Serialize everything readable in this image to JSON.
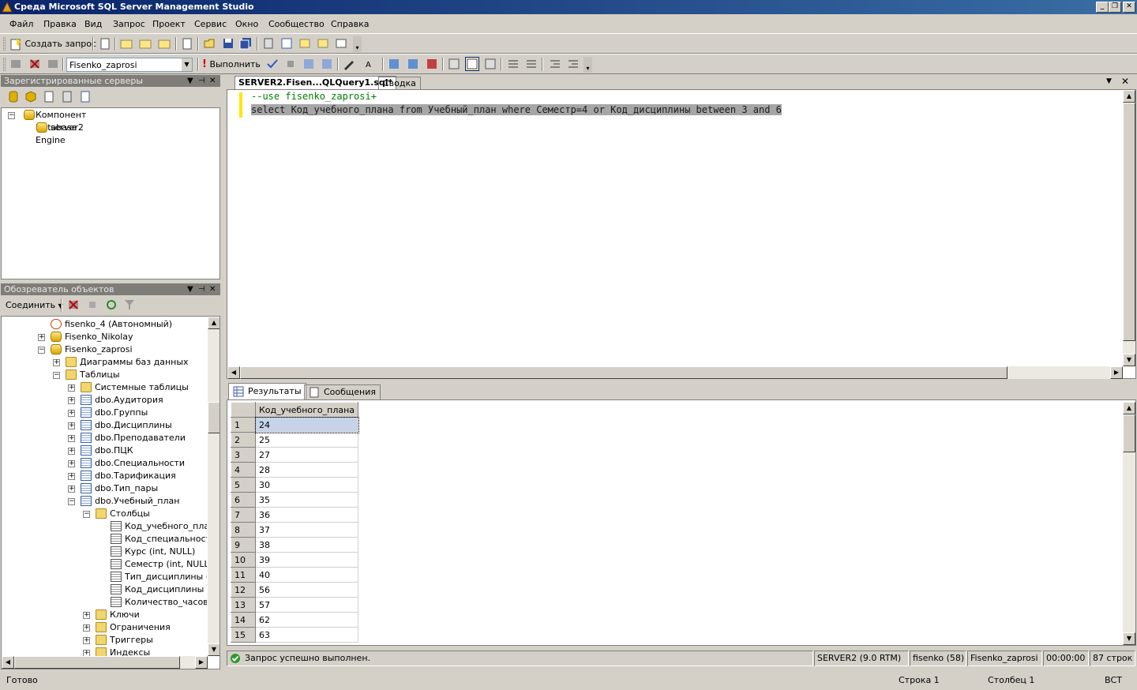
{
  "window": {
    "title": "Среда Microsoft SQL Server Management Studio"
  },
  "menu": [
    "Файл",
    "Правка",
    "Вид",
    "Запрос",
    "Проект",
    "Сервис",
    "Окно",
    "Сообщество",
    "Справка"
  ],
  "toolbar1": {
    "new_query": "Создать запрос"
  },
  "toolbar2": {
    "database": "Fisenko_zaprosi",
    "execute": "Выполнить"
  },
  "registered_servers": {
    "title": "Зарегистрированные серверы",
    "root": "Компонент Database Engine",
    "server": "server2"
  },
  "object_explorer": {
    "title": "Обозреватель объектов",
    "connect": "Соединить",
    "nodes": [
      {
        "label": "fisenko_4 (Автономный)"
      },
      {
        "label": "Fisenko_Nikolay"
      },
      {
        "label": "Fisenko_zaprosi"
      },
      {
        "label": "Диаграммы баз данных"
      },
      {
        "label": "Таблицы"
      },
      {
        "label": "Системные таблицы"
      },
      {
        "label": "dbo.Аудитория"
      },
      {
        "label": "dbo.Группы"
      },
      {
        "label": "dbo.Дисциплины"
      },
      {
        "label": "dbo.Преподаватели"
      },
      {
        "label": "dbo.ПЦК"
      },
      {
        "label": "dbo.Специальности"
      },
      {
        "label": "dbo.Тарификация"
      },
      {
        "label": "dbo.Тип_пары"
      },
      {
        "label": "dbo.Учебный_план"
      },
      {
        "label": "Столбцы"
      },
      {
        "label": "Код_учебного_план"
      },
      {
        "label": "Код_специальности"
      },
      {
        "label": "Курс (int, NULL)"
      },
      {
        "label": "Семестр (int, NULL)"
      },
      {
        "label": "Тип_дисциплины (va"
      },
      {
        "label": "Код_дисциплины (in"
      },
      {
        "label": "Количество_часов (i"
      },
      {
        "label": "Ключи"
      },
      {
        "label": "Ограничения"
      },
      {
        "label": "Триггеры"
      },
      {
        "label": "Индексы"
      }
    ]
  },
  "tabs": {
    "query": "SERVER2.Fisen...QLQuery1.sql*",
    "summary": "Сводка"
  },
  "editor": {
    "line1": "--use fisenko_zaprosi+",
    "line2": "select Код_учебного_плана from Учебный_план where Семестр=4 or Код_дисциплины between 3 and 6"
  },
  "results": {
    "tab_results": "Результаты",
    "tab_messages": "Сообщения",
    "column": "Код_учебного_плана",
    "rows": [
      {
        "n": "1",
        "v": "24"
      },
      {
        "n": "2",
        "v": "25"
      },
      {
        "n": "3",
        "v": "27"
      },
      {
        "n": "4",
        "v": "28"
      },
      {
        "n": "5",
        "v": "30"
      },
      {
        "n": "6",
        "v": "35"
      },
      {
        "n": "7",
        "v": "36"
      },
      {
        "n": "8",
        "v": "37"
      },
      {
        "n": "9",
        "v": "38"
      },
      {
        "n": "10",
        "v": "39"
      },
      {
        "n": "11",
        "v": "40"
      },
      {
        "n": "12",
        "v": "56"
      },
      {
        "n": "13",
        "v": "57"
      },
      {
        "n": "14",
        "v": "62"
      },
      {
        "n": "15",
        "v": "63"
      }
    ]
  },
  "query_status": {
    "message": "Запрос успешно выполнен.",
    "server": "SERVER2 (9.0 RTM)",
    "user": "fisenko (58)",
    "database": "Fisenko_zaprosi",
    "time": "00:00:00",
    "rows": "87 строк"
  },
  "statusbar": {
    "ready": "Готово",
    "line": "Строка 1",
    "column": "Столбец 1",
    "mode": "ВСТ"
  }
}
